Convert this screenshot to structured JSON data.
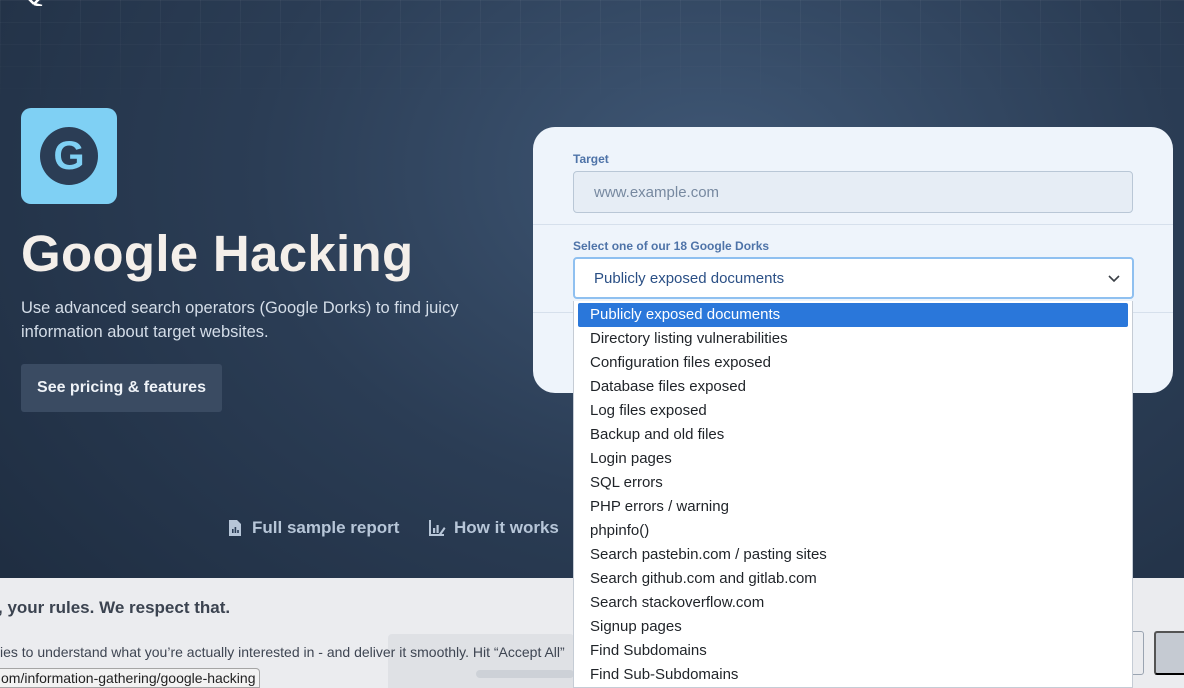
{
  "hero": {
    "icon_letter": "G",
    "title": "Google Hacking",
    "description": "Use advanced search operators (Google Dorks) to find juicy information about target websites.",
    "pricing_button": "See pricing & features"
  },
  "form": {
    "target_label": "Target",
    "target_placeholder": "www.example.com",
    "dork_label": "Select one of our 18 Google Dorks",
    "selected_dork": "Publicly exposed documents",
    "options": [
      "Publicly exposed documents",
      "Directory listing vulnerabilities",
      "Configuration files exposed",
      "Database files exposed",
      "Log files exposed",
      "Backup and old files",
      "Login pages",
      "SQL errors",
      "PHP errors / warning",
      "phpinfo()",
      "Search pastebin.com / pasting sites",
      "Search github.com and gitlab.com",
      "Search stackoverflow.com",
      "Signup pages",
      "Find Subdomains",
      "Find Sub-Subdomains"
    ]
  },
  "links": {
    "sample_report": "Full sample report",
    "how_it_works": "How it works"
  },
  "cookie": {
    "title": ", your rules. We respect that.",
    "text": "ies to understand what you’re actually interested in - and deliver it smoothly. Hit “Accept All”"
  },
  "status_url": "om/information-gathering/google-hacking",
  "colors": {
    "accent_blue": "#2a77da",
    "icon_bg": "#7fd0f4",
    "label_blue": "#4e73a8",
    "card_bg": "#eef4fb"
  },
  "icons": {
    "top_logo": "x-logo-icon",
    "select_chevron": "chevron-down-icon",
    "sample_report": "document-chart-icon",
    "how_it_works": "chart-edit-icon"
  }
}
